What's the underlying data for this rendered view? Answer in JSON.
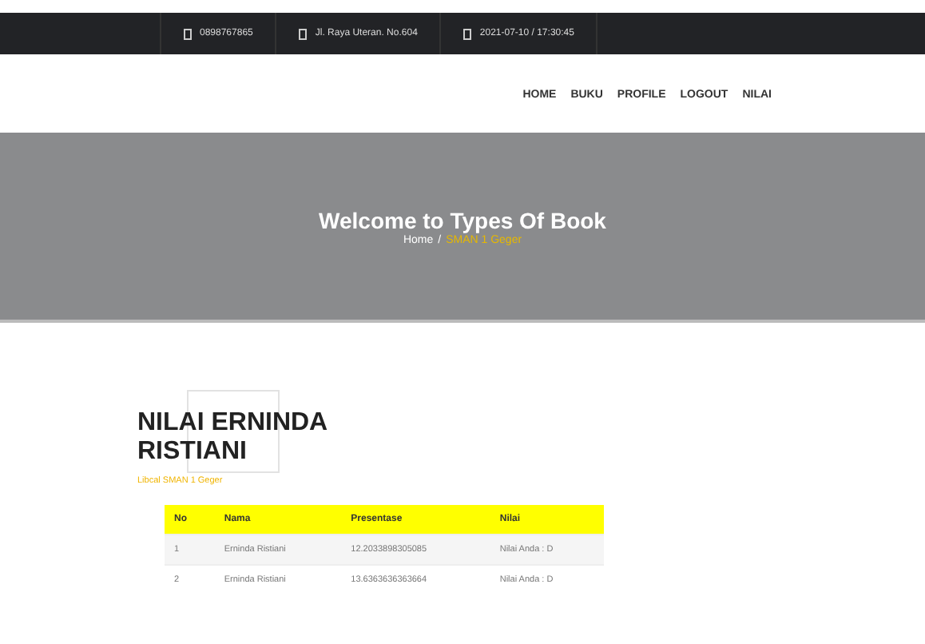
{
  "topbar": [
    {
      "text": "0898767865"
    },
    {
      "text": "Jl. Raya Uteran. No.604"
    },
    {
      "text": "2021-07-10 / 17:30:45"
    }
  ],
  "nav": [
    {
      "label": "HOME"
    },
    {
      "label": "BUKU"
    },
    {
      "label": "PROFILE"
    },
    {
      "label": "LOGOUT"
    },
    {
      "label": "NILAI"
    }
  ],
  "hero": {
    "title": "Welcome to Types Of Book",
    "crumb_home": "Home",
    "separator": "/",
    "crumb_current": "SMAN 1 Geger"
  },
  "heading": "NILAI ERNINDA RISTIANI",
  "subtitle": "Libcal SMAN 1 Geger",
  "table": {
    "columns": [
      "No",
      "Nama",
      "Presentase",
      "Nilai"
    ],
    "rows": [
      [
        "1",
        "Erninda Ristiani",
        "12.2033898305085",
        "Nilai Anda : D"
      ],
      [
        "2",
        "Erninda Ristiani",
        "13.6363636363664",
        "Nilai Anda : D"
      ]
    ]
  }
}
